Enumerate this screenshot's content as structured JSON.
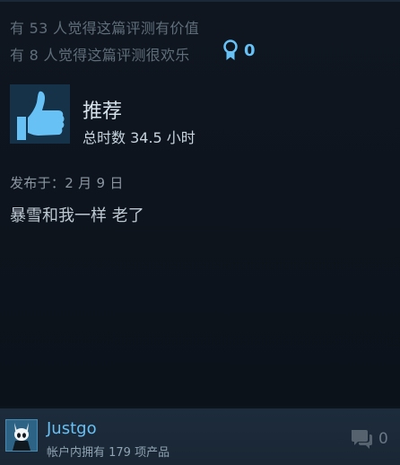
{
  "review": {
    "helpful_text": "有 53 人觉得这篇评测有价值",
    "funny_text": "有 8 人觉得这篇评测很欢乐",
    "award_count": "0",
    "award_icon": "award-ribbon-icon",
    "recommendation": "推荐",
    "recommendation_icon": "thumbs-up-icon",
    "hours": "总时数 34.5 小时",
    "posted": "发布于：2 月 9 日",
    "text": "暴雪和我一样 老了"
  },
  "author": {
    "name": "Justgo",
    "products": "帐户内拥有 179 项产品",
    "avatar_icon": "hollow-knight-avatar"
  },
  "comments": {
    "count": "0",
    "icon": "comment-bubbles-icon"
  },
  "colors": {
    "background": "#0e141c",
    "accent_blue": "#67c1f5",
    "thumb_bg": "#163249",
    "thumb_fg": "#67c1f5",
    "author_bar": "#1d2c3c"
  }
}
